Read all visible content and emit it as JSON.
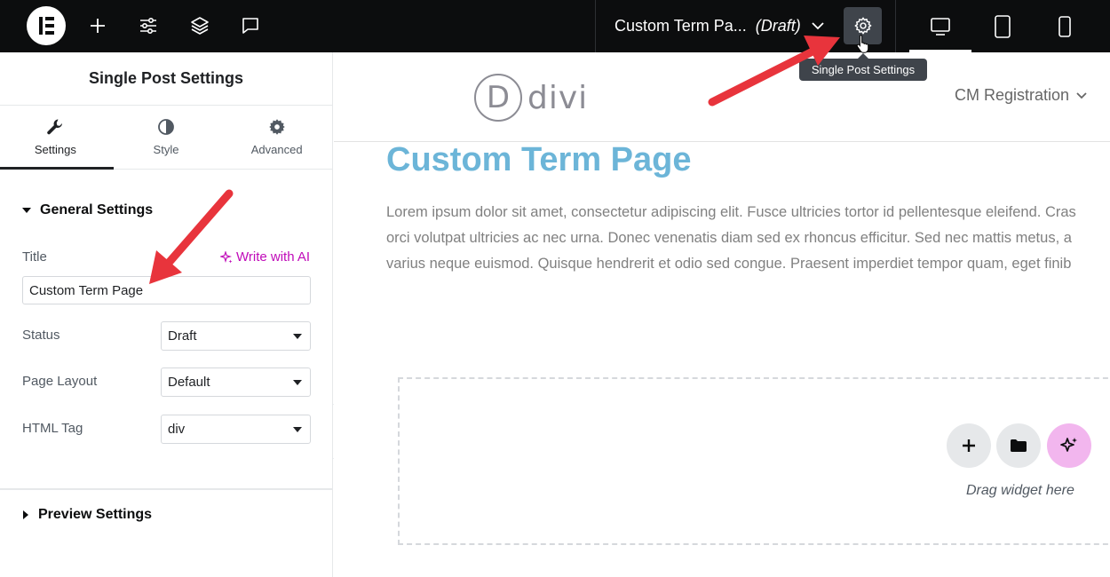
{
  "topbar": {
    "logo_icon": "elementor-logo-icon",
    "tools": [
      {
        "name": "add-element",
        "icon": "plus-icon"
      },
      {
        "name": "site-settings",
        "icon": "sliders-icon"
      },
      {
        "name": "structure",
        "icon": "layers-icon"
      },
      {
        "name": "notes",
        "icon": "comment-icon"
      }
    ],
    "document_title": "Custom Term Pa...",
    "document_status": "(Draft)",
    "settings_icon": "gear-icon",
    "devices": [
      "desktop-icon",
      "tablet-icon",
      "mobile-icon"
    ],
    "tooltip": "Single Post Settings"
  },
  "panel": {
    "title": "Single Post Settings",
    "tabs": [
      {
        "label": "Settings",
        "icon": "wrench-icon",
        "active": true
      },
      {
        "label": "Style",
        "icon": "half-circle-icon",
        "active": false
      },
      {
        "label": "Advanced",
        "icon": "cog-icon",
        "active": false
      }
    ],
    "general_section": "General Settings",
    "title_label": "Title",
    "write_ai": "Write with AI",
    "title_value": "Custom Term Page",
    "status_label": "Status",
    "status_value": "Draft",
    "layout_label": "Page Layout",
    "layout_value": "Default",
    "html_tag_label": "HTML Tag",
    "html_tag_value": "div",
    "preview_section": "Preview Settings"
  },
  "preview": {
    "logo_letter": "D",
    "logo_text": "divi",
    "menu_item": "CM Registration",
    "heading": "Custom Term Page",
    "paragraph_lines": [
      "Lorem ipsum dolor sit amet, consectetur adipiscing elit. Fusce ultricies tortor id pellentesque eleifend. Cras",
      "orci volutpat ultricies ac nec urna. Donec venenatis diam sed ex rhoncus efficitur. Sed nec mattis metus, a",
      "varius neque euismod. Quisque hendrerit et odio sed congue. Praesent imperdiet tempor quam, eget finib"
    ],
    "drop_text": "Drag widget here"
  },
  "colors": {
    "topbar": "#0c0d0e",
    "heading": "#6cb5d8",
    "ai_accent": "#c00bb9",
    "annotation_arrow": "#e8343c"
  }
}
